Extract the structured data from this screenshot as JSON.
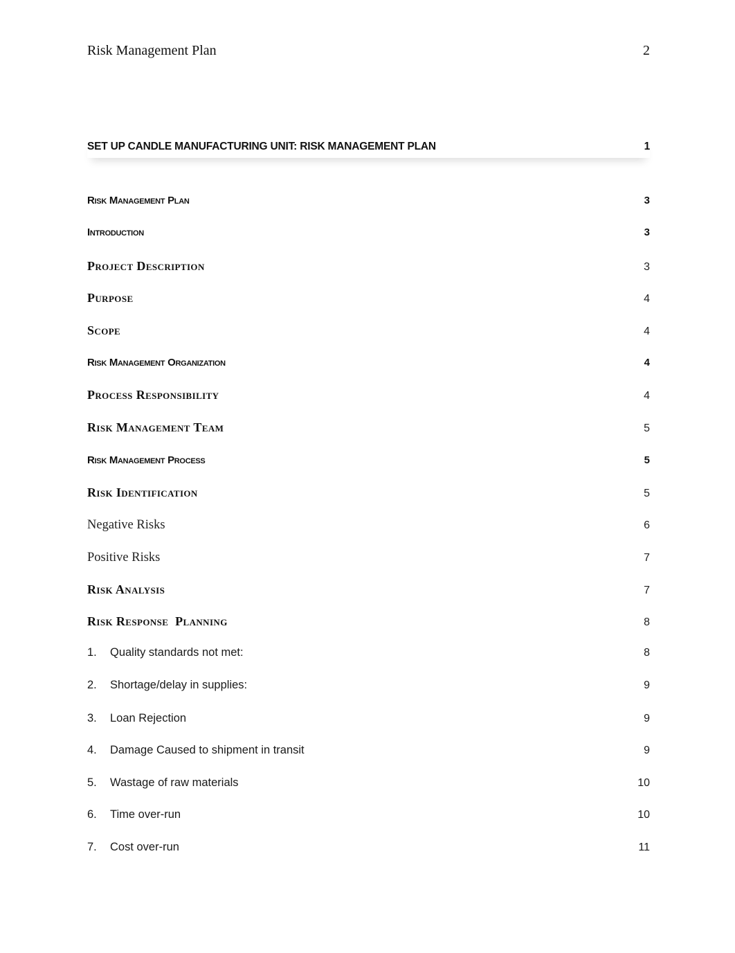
{
  "header": {
    "running_title": "Risk Management Plan",
    "page_number": "2"
  },
  "toc": {
    "title_entry": {
      "label": "SET UP CANDLE MANUFACTURING UNIT: RISK MANAGEMENT PLAN",
      "page": "1"
    },
    "entries": [
      {
        "label": "Risk Management Plan",
        "page": "3",
        "style": "sans-sc"
      },
      {
        "label": "Introduction",
        "page": "3",
        "style": "sans-sc"
      },
      {
        "label": "Project Description",
        "page": "3",
        "style": "serif-sc"
      },
      {
        "label": "Purpose",
        "page": "4",
        "style": "serif-sc"
      },
      {
        "label": "Scope",
        "page": "4",
        "style": "serif-sc"
      },
      {
        "label": "Risk Management Organization",
        "page": "4",
        "style": "sans-sc"
      },
      {
        "label": "Process Responsibility",
        "page": "4",
        "style": "serif-sc"
      },
      {
        "label": "Risk Management Team",
        "page": "5",
        "style": "serif-sc"
      },
      {
        "label": "Risk Management Process",
        "page": "5",
        "style": "sans-sc"
      },
      {
        "label": "Risk Identification",
        "page": "5",
        "style": "serif-sc"
      },
      {
        "label": "Negative Risks",
        "page": "6",
        "style": "serif"
      },
      {
        "label": "Positive Risks",
        "page": "7",
        "style": "serif"
      },
      {
        "label": "Risk Analysis",
        "page": "7",
        "style": "serif-sc"
      },
      {
        "label": "Risk Response  Planning",
        "page": "8",
        "style": "serif-sc"
      }
    ],
    "list_entries": [
      {
        "index": "1.",
        "label": "Quality standards not met:",
        "page": "8"
      },
      {
        "index": "2.",
        "label": "Shortage/delay in supplies:",
        "page": "9"
      },
      {
        "index": "3.",
        "label": "Loan Rejection",
        "page": "9"
      },
      {
        "index": "4.",
        "label": "Damage Caused to shipment in transit",
        "page": "9"
      },
      {
        "index": "5.",
        "label": "Wastage of raw materials",
        "page": "10"
      },
      {
        "index": "6.",
        "label": "Time over-run",
        "page": "10"
      },
      {
        "index": "7.",
        "label": "Cost over-run",
        "page": "11"
      }
    ]
  }
}
